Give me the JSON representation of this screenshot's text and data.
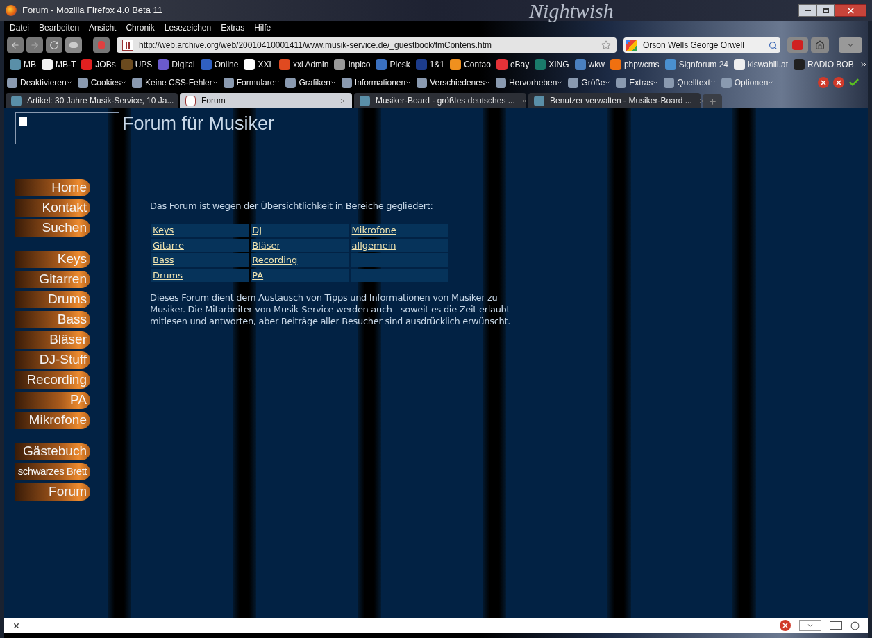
{
  "window": {
    "title": "Forum - Mozilla Firefox 4.0 Beta 11",
    "theme_logo": "Nightwish"
  },
  "menu": [
    "Datei",
    "Bearbeiten",
    "Ansicht",
    "Chronik",
    "Lesezeichen",
    "Extras",
    "Hilfe"
  ],
  "navigation": {
    "url": "http://web.archive.org/web/20010410001411/www.musik-service.de/_guestbook/fmContens.htm",
    "search": "Orson Wells George Orwell"
  },
  "bookmarks": [
    {
      "label": "MB",
      "color": "#5a8fa8"
    },
    {
      "label": "MB-T",
      "color": "#f0f0f0"
    },
    {
      "label": "JOBs",
      "color": "#e02020"
    },
    {
      "label": "UPS",
      "color": "#6b4a1e"
    },
    {
      "label": "Digital",
      "color": "#6a5acd"
    },
    {
      "label": "Online",
      "color": "#3060c0"
    },
    {
      "label": "XXL",
      "color": "#ffffff"
    },
    {
      "label": "xxl Admin",
      "color": "#e04a20"
    },
    {
      "label": "Inpico",
      "color": "#999999"
    },
    {
      "label": "Plesk",
      "color": "#3a70c0"
    },
    {
      "label": "1&1",
      "color": "#1c3c8c"
    },
    {
      "label": "Contao",
      "color": "#f0901e"
    },
    {
      "label": "eBay",
      "color": "#e53238"
    },
    {
      "label": "XING",
      "color": "#1a7a6a"
    },
    {
      "label": "wkw",
      "color": "#4a80c0"
    },
    {
      "label": "phpwcms",
      "color": "#f07010"
    },
    {
      "label": "Signforum 24",
      "color": "#4a90d0"
    },
    {
      "label": "kiswahili.at",
      "color": "#f0f0f0"
    },
    {
      "label": "RADIO BOB",
      "color": "#202020"
    }
  ],
  "developer_toolbar": [
    "Deaktivieren",
    "Cookies",
    "Keine CSS-Fehler",
    "Formulare",
    "Grafiken",
    "Informationen",
    "Verschiedenes",
    "Hervorheben",
    "Größe",
    "Extras",
    "Quelltext",
    "Optionen"
  ],
  "tabs": [
    {
      "label": "Artikel: 30 Jahre Musik-Service, 10 Ja...",
      "selected": false
    },
    {
      "label": "Forum",
      "selected": true
    },
    {
      "label": "Musiker-Board - größtes deutsches ...",
      "selected": false
    },
    {
      "label": "Benutzer verwalten - Musiker-Board ...",
      "selected": false
    }
  ],
  "page": {
    "heading": "Forum für Musiker",
    "sidebar": [
      [
        "Home",
        "Kontakt",
        "Suchen"
      ],
      [
        "Keys",
        "Gitarren",
        "Drums",
        "Bass",
        "Bläser",
        "DJ-Stuff",
        "Recording",
        "PA",
        "Mikrofone"
      ],
      [
        "Gästebuch",
        "schwarzes Brett",
        "Forum"
      ]
    ],
    "intro": "Das Forum ist wegen der Übersichtlichkeit in Bereiche gegliedert:",
    "forum_table": [
      [
        "Keys",
        "DJ",
        "Mikrofone"
      ],
      [
        "Gitarre",
        "Bläser",
        "allgemein"
      ],
      [
        "Bass",
        "Recording"
      ],
      [
        "Drums",
        "PA"
      ]
    ],
    "description": "Dieses Forum dient dem Austausch von Tipps und Informationen von Musiker zu Musiker. Die Mitarbeiter von Musik-Service werden auch - soweit es die Zeit erlaubt - mitlesen und antworten, aber Beiträge aller Besucher sind ausdrücklich erwünscht."
  }
}
